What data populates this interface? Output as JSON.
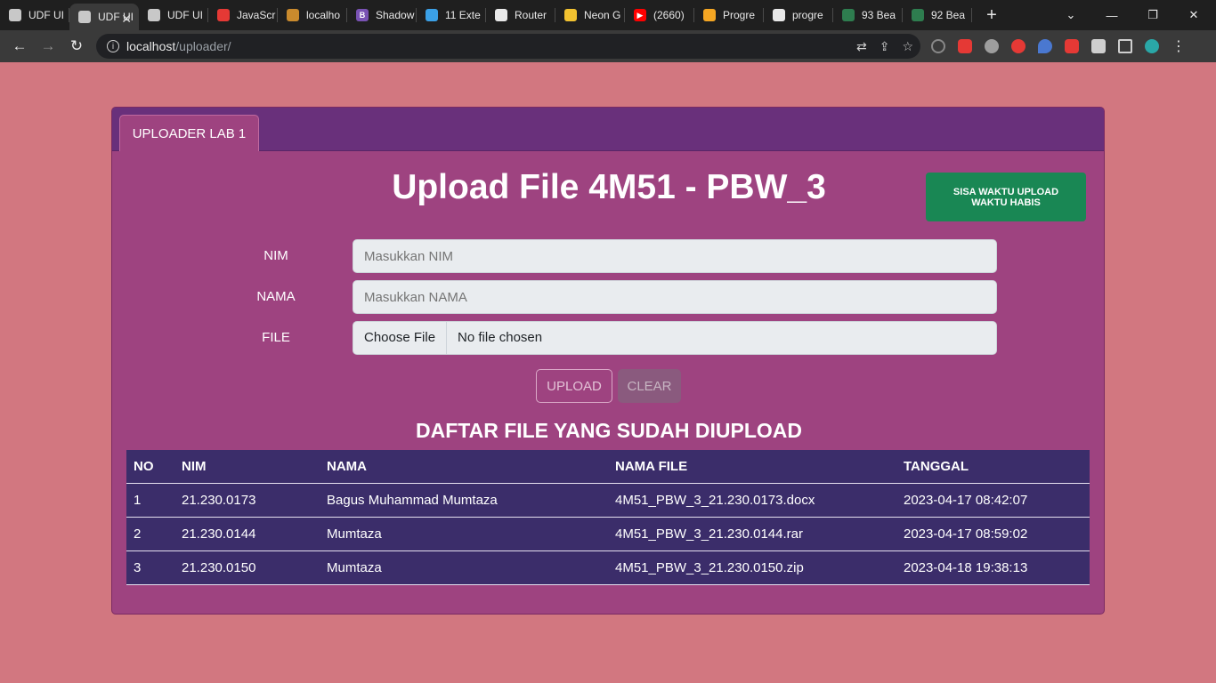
{
  "browser": {
    "tabs": [
      {
        "label": "UDF UI",
        "favicon_color": "#c8c8c8",
        "glyph": "",
        "active": false
      },
      {
        "label": "UDF UI",
        "favicon_color": "#c8c8c8",
        "glyph": "",
        "active": true
      },
      {
        "label": "UDF UI",
        "favicon_color": "#c8c8c8",
        "glyph": "",
        "active": false
      },
      {
        "label": "JavaScr",
        "favicon_color": "#e53935",
        "glyph": "",
        "active": false
      },
      {
        "label": "localho",
        "favicon_color": "#c98a2d",
        "glyph": "",
        "active": false
      },
      {
        "label": "Shadow",
        "favicon_color": "#7952b3",
        "glyph": "B",
        "active": false
      },
      {
        "label": "11 Exte",
        "favicon_color": "#3ba0e6",
        "glyph": "",
        "active": false
      },
      {
        "label": "Router",
        "favicon_color": "#e8e8e8",
        "glyph": "",
        "active": false
      },
      {
        "label": "Neon G",
        "favicon_color": "#f2c230",
        "glyph": "",
        "active": false
      },
      {
        "label": "(2660)",
        "favicon_color": "#ff0000",
        "glyph": "▶",
        "active": false
      },
      {
        "label": "Progre",
        "favicon_color": "#f5a623",
        "glyph": "",
        "active": false
      },
      {
        "label": "progre",
        "favicon_color": "#e8e8e8",
        "glyph": "",
        "active": false
      },
      {
        "label": "93 Bea",
        "favicon_color": "#2e7d4f",
        "glyph": "",
        "active": false
      },
      {
        "label": "92 Bea",
        "favicon_color": "#2e7d4f",
        "glyph": "",
        "active": false
      }
    ],
    "new_tab_glyph": "+",
    "url_host": "localhost",
    "url_path": "/uploader/"
  },
  "page": {
    "tab_label": "UPLOADER LAB 1",
    "title": "Upload File 4M51 - PBW_3",
    "timer_line1": "SISA WAKTU UPLOAD",
    "timer_line2": "WAKTU HABIS",
    "form": {
      "nim_label": "NIM",
      "nim_placeholder": "Masukkan NIM",
      "nama_label": "NAMA",
      "nama_placeholder": "Masukkan NAMA",
      "file_label": "FILE",
      "file_button": "Choose File",
      "file_status": "No file chosen"
    },
    "upload_label": "UPLOAD",
    "clear_label": "CLEAR",
    "list_title": "DAFTAR FILE YANG SUDAH DIUPLOAD",
    "table": {
      "headers": [
        "NO",
        "NIM",
        "NAMA",
        "NAMA FILE",
        "TANGGAL"
      ],
      "rows": [
        [
          "1",
          "21.230.0173",
          "Bagus Muhammad Mumtaza",
          "4M51_PBW_3_21.230.0173.docx",
          "2023-04-17 08:42:07"
        ],
        [
          "2",
          "21.230.0144",
          "Mumtaza",
          "4M51_PBW_3_21.230.0144.rar",
          "2023-04-17 08:59:02"
        ],
        [
          "3",
          "21.230.0150",
          "Mumtaza",
          "4M51_PBW_3_21.230.0150.zip",
          "2023-04-18 19:38:13"
        ]
      ]
    }
  },
  "colors": {
    "page_bg": "#d27780",
    "card_bg": "#9e4380",
    "header_bg": "#69307b",
    "table_bg": "#3b2d6a",
    "timer_bg": "#198754"
  }
}
